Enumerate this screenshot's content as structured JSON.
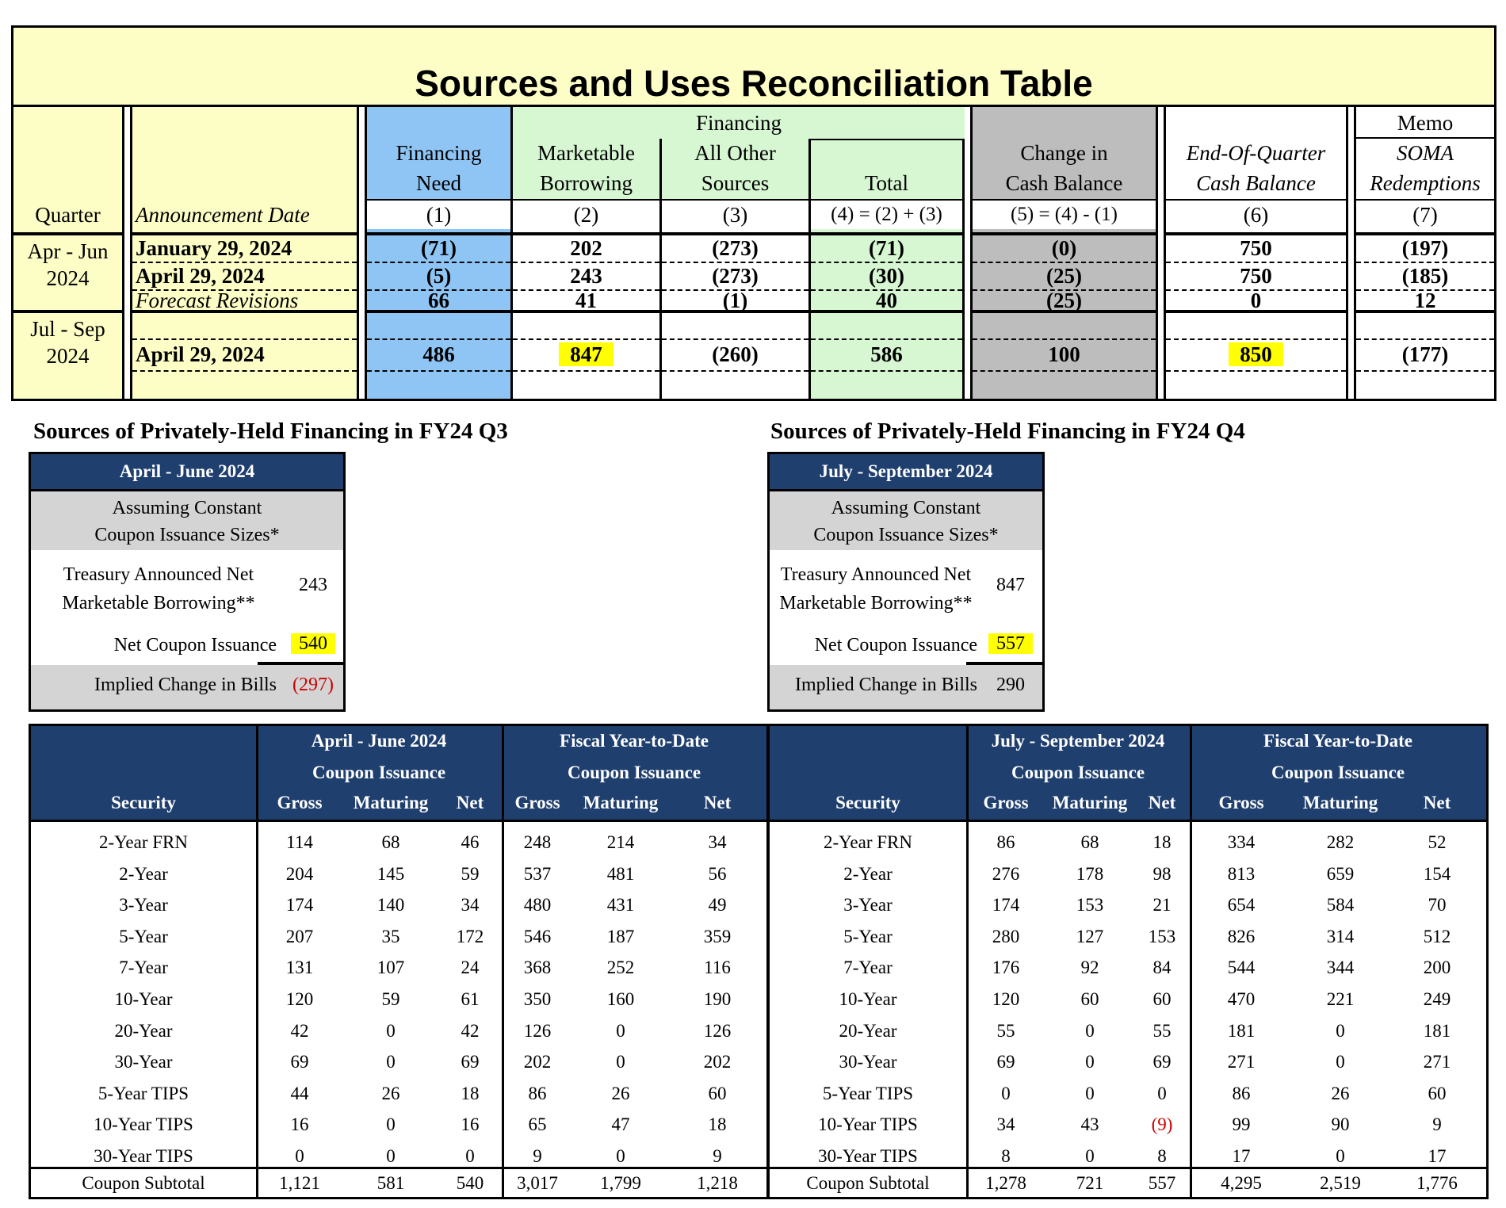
{
  "recon": {
    "title": "Sources and Uses Reconciliation Table",
    "header": {
      "financing_group": "Financing",
      "memo_group": "Memo",
      "quarter": "Quarter",
      "announcement_date": "Announcement Date",
      "columns": [
        {
          "l1": "Financing",
          "l2": "Need",
          "num": "(1)"
        },
        {
          "l1": "Marketable",
          "l2": "Borrowing",
          "num": "(2)"
        },
        {
          "l1": "All Other",
          "l2": "Sources",
          "num": "(3)"
        },
        {
          "l1": "",
          "l2": "Total",
          "num": "(4) = (2) + (3)"
        },
        {
          "l1": "Change in",
          "l2": "Cash Balance",
          "num": "(5) = (4) - (1)"
        },
        {
          "l1": "End-Of-Quarter",
          "l2": "Cash Balance",
          "num": "(6)"
        },
        {
          "l1": "SOMA",
          "l2": "Redemptions",
          "num": "(7)"
        }
      ]
    },
    "q1": {
      "quarter_l1": "Apr - Jun",
      "quarter_l2": "2024",
      "rows": [
        {
          "date": "January 29, 2024",
          "v": [
            "(71)",
            "202",
            "(273)",
            "(71)",
            "(0)",
            "750",
            "(197)"
          ]
        },
        {
          "date": "April 29, 2024",
          "v": [
            "(5)",
            "243",
            "(273)",
            "(30)",
            "(25)",
            "750",
            "(185)"
          ]
        },
        {
          "date": "Forecast Revisions",
          "v": [
            "66",
            "41",
            "(1)",
            "40",
            "(25)",
            "0",
            "12"
          ]
        }
      ]
    },
    "q2": {
      "quarter_l1": "Jul - Sep",
      "quarter_l2": "2024",
      "rows": [
        {
          "date": "April 29, 2024",
          "v": [
            "486",
            "847",
            "(260)",
            "586",
            "100",
            "850",
            "(177)"
          ]
        }
      ]
    }
  },
  "q3box": {
    "title": "Sources of Privately-Held Financing in FY24 Q3",
    "head": "April - June 2024",
    "gray_l1": "Assuming Constant",
    "gray_l2": "Coupon Issuance Sizes*",
    "row1_l1": "Treasury Announced Net",
    "row1_l2": "Marketable Borrowing**",
    "row1_v": "243",
    "row2": "Net Coupon Issuance",
    "row2_v": "540",
    "row3": "Implied Change in Bills",
    "row3_v": "(297)"
  },
  "q4box": {
    "title": "Sources of Privately-Held Financing in FY24 Q4",
    "head": "July - September 2024",
    "gray_l1": "Assuming Constant",
    "gray_l2": "Coupon Issuance Sizes*",
    "row1_l1": "Treasury Announced Net",
    "row1_l2": "Marketable Borrowing**",
    "row1_v": "847",
    "row2": "Net Coupon Issuance",
    "row2_v": "557",
    "row3": "Implied Change in Bills",
    "row3_v": "290"
  },
  "coupon_left": {
    "period": "April - June 2024",
    "ytd": "Fiscal Year-to-Date",
    "issuance": "Coupon Issuance",
    "security": "Security",
    "gross": "Gross",
    "maturing": "Maturing",
    "net": "Net",
    "rows": [
      [
        "2-Year FRN",
        "114",
        "68",
        "46",
        "248",
        "214",
        "34"
      ],
      [
        "2-Year",
        "204",
        "145",
        "59",
        "537",
        "481",
        "56"
      ],
      [
        "3-Year",
        "174",
        "140",
        "34",
        "480",
        "431",
        "49"
      ],
      [
        "5-Year",
        "207",
        "35",
        "172",
        "546",
        "187",
        "359"
      ],
      [
        "7-Year",
        "131",
        "107",
        "24",
        "368",
        "252",
        "116"
      ],
      [
        "10-Year",
        "120",
        "59",
        "61",
        "350",
        "160",
        "190"
      ],
      [
        "20-Year",
        "42",
        "0",
        "42",
        "126",
        "0",
        "126"
      ],
      [
        "30-Year",
        "69",
        "0",
        "69",
        "202",
        "0",
        "202"
      ],
      [
        "5-Year TIPS",
        "44",
        "26",
        "18",
        "86",
        "26",
        "60"
      ],
      [
        "10-Year TIPS",
        "16",
        "0",
        "16",
        "65",
        "47",
        "18"
      ],
      [
        "30-Year TIPS",
        "0",
        "0",
        "0",
        "9",
        "0",
        "9"
      ]
    ],
    "subtotal": [
      "Coupon Subtotal",
      "1,121",
      "581",
      "540",
      "3,017",
      "1,799",
      "1,218"
    ]
  },
  "coupon_right": {
    "period": "July - September 2024",
    "ytd": "Fiscal Year-to-Date",
    "issuance": "Coupon Issuance",
    "security": "Security",
    "gross": "Gross",
    "maturing": "Maturing",
    "net": "Net",
    "rows": [
      [
        "2-Year FRN",
        "86",
        "68",
        "18",
        "334",
        "282",
        "52"
      ],
      [
        "2-Year",
        "276",
        "178",
        "98",
        "813",
        "659",
        "154"
      ],
      [
        "3-Year",
        "174",
        "153",
        "21",
        "654",
        "584",
        "70"
      ],
      [
        "5-Year",
        "280",
        "127",
        "153",
        "826",
        "314",
        "512"
      ],
      [
        "7-Year",
        "176",
        "92",
        "84",
        "544",
        "344",
        "200"
      ],
      [
        "10-Year",
        "120",
        "60",
        "60",
        "470",
        "221",
        "249"
      ],
      [
        "20-Year",
        "55",
        "0",
        "55",
        "181",
        "0",
        "181"
      ],
      [
        "30-Year",
        "69",
        "0",
        "69",
        "271",
        "0",
        "271"
      ],
      [
        "5-Year TIPS",
        "0",
        "0",
        "0",
        "86",
        "26",
        "60"
      ],
      [
        "10-Year TIPS",
        "34",
        "43",
        "(9)",
        "99",
        "90",
        "9"
      ],
      [
        "30-Year TIPS",
        "8",
        "0",
        "8",
        "17",
        "0",
        "17"
      ]
    ],
    "subtotal": [
      "Coupon Subtotal",
      "1,278",
      "721",
      "557",
      "4,295",
      "2,519",
      "1,776"
    ]
  },
  "colors": {
    "title_bg": "#fdfdc6",
    "blue_col": "#8ec5f5",
    "green_col": "#d6f7d2",
    "gray_col": "#bdbdbd",
    "header_navy": "#1f3f6e",
    "highlight": "#ffff00",
    "negative_red": "#d00000"
  }
}
